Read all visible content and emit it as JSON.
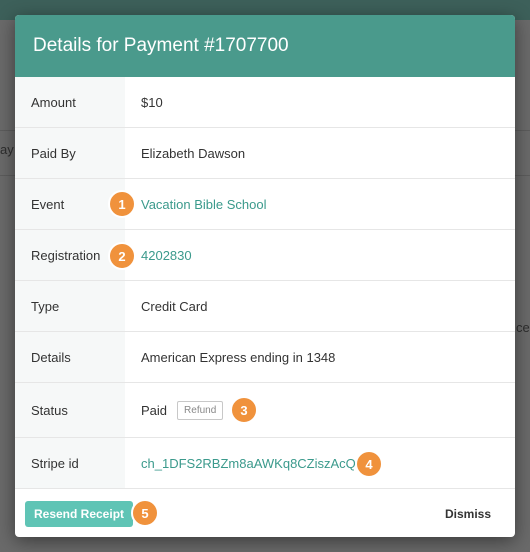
{
  "background": {
    "fragment_left": "ay",
    "fragment_right": "ce"
  },
  "modal": {
    "title": "Details for Payment #1707700",
    "rows": [
      {
        "label": "Amount",
        "value": "$10"
      },
      {
        "label": "Paid By",
        "value": "Elizabeth Dawson"
      },
      {
        "label": "Event",
        "value": "Vacation Bible School",
        "link": true
      },
      {
        "label": "Registration",
        "value": "4202830",
        "link": true
      },
      {
        "label": "Type",
        "value": "Credit Card"
      },
      {
        "label": "Details",
        "value": "American Express ending in 1348"
      },
      {
        "label": "Status",
        "value": "Paid",
        "action": "Refund"
      },
      {
        "label": "Stripe id",
        "value": "ch_1DFS2RBZm8aAWKq8CZiszAcQ",
        "link": true
      }
    ],
    "footer": {
      "resend_label": "Resend Receipt",
      "dismiss_label": "Dismiss"
    }
  },
  "badges": [
    "1",
    "2",
    "3",
    "4",
    "5"
  ],
  "colors": {
    "header": "#4a9a8c",
    "link": "#3b9a8c",
    "badge": "#f0923c",
    "primary_button": "#5fc4b5"
  }
}
